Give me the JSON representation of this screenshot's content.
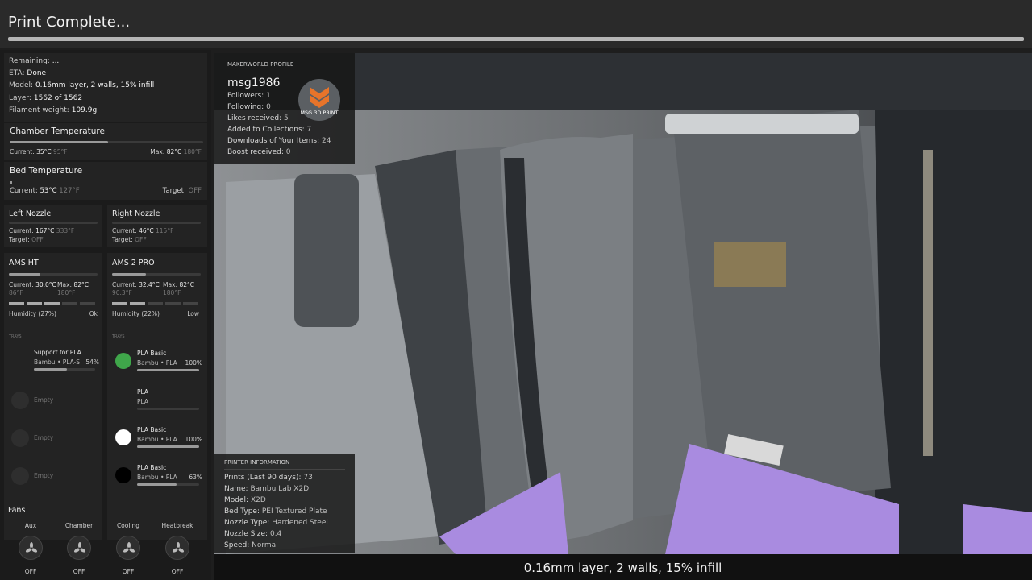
{
  "header": {
    "title": "Print Complete...",
    "progress_percent": 100
  },
  "status": {
    "remaining_label": "Remaining:",
    "remaining_value": "...",
    "eta_label": "ETA:",
    "eta_value": "Done",
    "model_label": "Model:",
    "model_value": "0.16mm layer, 2 walls, 15% infill",
    "layer_label": "Layer:",
    "layer_value": "1562 of 1562",
    "weight_label": "Filament weight:",
    "weight_value": "109.9g"
  },
  "chamber": {
    "title": "Chamber Temperature",
    "current_label": "Current:",
    "current_c": "35°C",
    "current_f": "95°F",
    "max_label": "Max:",
    "max_c": "82°C",
    "max_f": "180°F",
    "fill_fraction": 0.43
  },
  "bed": {
    "title": "Bed Temperature",
    "current_label": "Current:",
    "current_c": "53°C",
    "current_f": "127°F",
    "target_label": "Target:",
    "target_value": "OFF"
  },
  "left_nozzle": {
    "title": "Left Nozzle",
    "current_label": "Current:",
    "current_c": "167°C",
    "current_f": "333°F",
    "target_label": "Target:",
    "target_value": "OFF"
  },
  "right_nozzle": {
    "title": "Right Nozzle",
    "current_label": "Current:",
    "current_c": "46°C",
    "current_f": "115°F",
    "target_label": "Target:",
    "target_value": "OFF"
  },
  "ams_ht": {
    "title": "AMS HT",
    "current_label": "Current:",
    "current_c": "30.0°C",
    "current_f": "86°F",
    "max_label": "Max:",
    "max_c": "82°C",
    "max_f": "180°F",
    "humidity": "Humidity (27%)",
    "humidity_status": "Ok",
    "humidity_level": 3,
    "trays_label": "TRAYS",
    "trays": [
      {
        "name": "Support for PLA",
        "sub": "Bambu • PLA-S",
        "pct": "54%",
        "fill": 0.54,
        "color": "#2b2b2b"
      },
      {
        "name": "Empty"
      },
      {
        "name": "Empty"
      },
      {
        "name": "Empty"
      }
    ]
  },
  "ams_2_pro": {
    "title": "AMS 2 PRO",
    "current_label": "Current:",
    "current_c": "32.4°C",
    "current_f": "90.3°F",
    "max_label": "Max:",
    "max_c": "82°C",
    "max_f": "180°F",
    "humidity": "Humidity (22%)",
    "humidity_status": "Low",
    "humidity_level": 2,
    "trays_label": "TRAYS",
    "trays": [
      {
        "name": "PLA Basic",
        "sub": "Bambu • PLA",
        "pct": "100%",
        "fill": 1.0,
        "color": "#3fa64a"
      },
      {
        "name": "PLA",
        "sub": "PLA",
        "pct": "",
        "fill": 0.0,
        "color": "#232323"
      },
      {
        "name": "PLA Basic",
        "sub": "Bambu • PLA",
        "pct": "100%",
        "fill": 1.0,
        "color": "#ffffff"
      },
      {
        "name": "PLA Basic",
        "sub": "Bambu • PLA",
        "pct": "63%",
        "fill": 0.63,
        "color": "#000000"
      }
    ]
  },
  "fans": {
    "title": "Fans",
    "items": [
      {
        "name": "Aux",
        "state": "OFF",
        "icon": "fan-icon"
      },
      {
        "name": "Chamber",
        "state": "OFF",
        "icon": "fan-icon"
      },
      {
        "name": "Cooling",
        "state": "OFF",
        "icon": "fan-icon"
      },
      {
        "name": "Heatbreak",
        "state": "OFF",
        "icon": "fan-icon"
      }
    ]
  },
  "makerworld": {
    "header": "MAKERWORLD PROFILE",
    "username": "msg1986",
    "logo_text": "MSG 3D PRINT",
    "rows": [
      {
        "label": "Followers:",
        "value": "1"
      },
      {
        "label": "Following:",
        "value": "0"
      },
      {
        "label": "Likes received:",
        "value": "5"
      },
      {
        "label": "Added to Collections:",
        "value": "7"
      },
      {
        "label": "Downloads of Your Items:",
        "value": "24"
      },
      {
        "label": "Boost received:",
        "value": "0"
      }
    ]
  },
  "printer_info": {
    "header": "PRINTER INFORMATION",
    "rows": [
      {
        "label": "Prints (Last 90 days):",
        "value": "73"
      },
      {
        "label": "Name:",
        "value": "Bambu Lab X2D"
      },
      {
        "label": "Model:",
        "value": "X2D"
      },
      {
        "label": "Bed Type:",
        "value": "PEI Textured Plate"
      },
      {
        "label": "Nozzle Type:",
        "value": "Hardened Steel"
      },
      {
        "label": "Nozzle Size:",
        "value": "0.4"
      },
      {
        "label": "Speed:",
        "value": "Normal"
      }
    ]
  },
  "caption": "0.16mm layer, 2 walls, 15% infill",
  "colors": {
    "accent_green": "#3fa64a",
    "purple_bed": "#a98be0"
  }
}
